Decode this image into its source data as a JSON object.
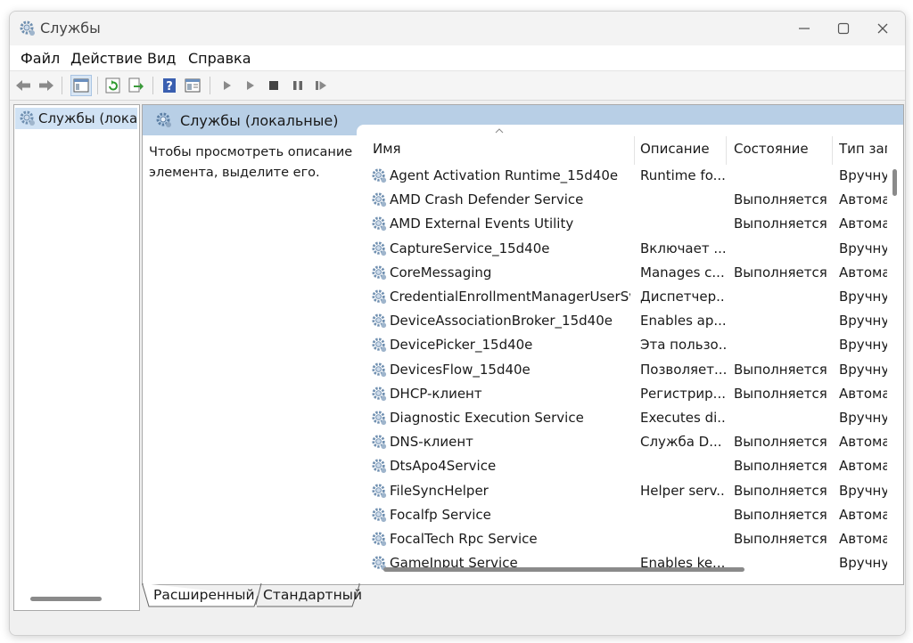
{
  "window": {
    "title": "Службы"
  },
  "menu": [
    "Файл",
    "Действие",
    "Вид",
    "Справка"
  ],
  "tree": {
    "item": "Службы (локальные)"
  },
  "main": {
    "header": "Службы (локальные)",
    "description": "Чтобы просмотреть описание элемента, выделите его.",
    "columns": {
      "name": "Имя",
      "description": "Описание",
      "status": "Состояние",
      "startup": "Тип запуска"
    },
    "rows": [
      {
        "name": "Agent Activation Runtime_15d40e",
        "description": "Runtime fo...",
        "status": "",
        "startup": "Вручную"
      },
      {
        "name": "AMD Crash Defender Service",
        "description": "",
        "status": "Выполняется",
        "startup": "Автоматически"
      },
      {
        "name": "AMD External Events Utility",
        "description": "",
        "status": "Выполняется",
        "startup": "Автоматически"
      },
      {
        "name": "CaptureService_15d40e",
        "description": "Включает ...",
        "status": "",
        "startup": "Вручную"
      },
      {
        "name": "CoreMessaging",
        "description": "Manages c...",
        "status": "Выполняется",
        "startup": "Автоматически"
      },
      {
        "name": "CredentialEnrollmentManagerUserSv...",
        "description": "Диспетчер...",
        "status": "",
        "startup": "Вручную"
      },
      {
        "name": "DeviceAssociationBroker_15d40e",
        "description": "Enables ap...",
        "status": "",
        "startup": "Вручную"
      },
      {
        "name": "DevicePicker_15d40e",
        "description": "Эта пользо...",
        "status": "",
        "startup": "Вручную"
      },
      {
        "name": "DevicesFlow_15d40e",
        "description": "Позволяет...",
        "status": "Выполняется",
        "startup": "Вручную"
      },
      {
        "name": "DHCP-клиент",
        "description": "Регистрир...",
        "status": "Выполняется",
        "startup": "Автоматически"
      },
      {
        "name": "Diagnostic Execution Service",
        "description": "Executes di...",
        "status": "",
        "startup": "Вручную"
      },
      {
        "name": "DNS-клиент",
        "description": "Служба D...",
        "status": "Выполняется",
        "startup": "Автоматически"
      },
      {
        "name": "DtsApo4Service",
        "description": "",
        "status": "Выполняется",
        "startup": "Автоматически"
      },
      {
        "name": "FileSyncHelper",
        "description": "Helper serv...",
        "status": "Выполняется",
        "startup": "Вручную"
      },
      {
        "name": "Focalfp Service",
        "description": "",
        "status": "Выполняется",
        "startup": "Автоматически"
      },
      {
        "name": "FocalTech Rpc Service",
        "description": "",
        "status": "Выполняется",
        "startup": "Автоматически"
      },
      {
        "name": "GameInput Service",
        "description": "Enables ke...",
        "status": "",
        "startup": "Вручную"
      }
    ]
  },
  "tabs": [
    "Расширенный",
    "Стандартный"
  ]
}
